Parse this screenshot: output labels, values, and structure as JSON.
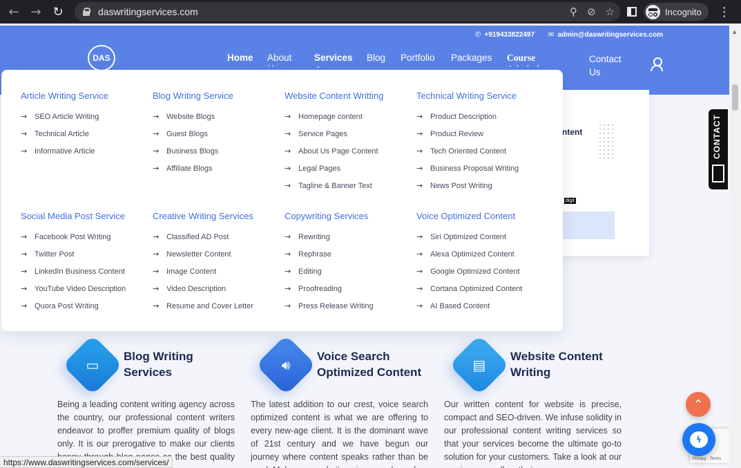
{
  "browser": {
    "url": "daswritingservices.com",
    "profile_label": "Incognito",
    "status_url": "https://www.daswritingservices.com/services/"
  },
  "site": {
    "phone": "+919433822497",
    "email": "admin@daswritingservices.com",
    "logo_text": "DAS",
    "nav": {
      "home": "Home",
      "about": "About Us",
      "services": "Services",
      "blog": "Blog",
      "portfolio": "Portfolio",
      "packages": "Packages",
      "course": "Course Admission",
      "contact": "Contact Us"
    },
    "hero_fragment": {
      "text": "ntent",
      "badge": "digit"
    },
    "colors": {
      "header": "#5a82e6",
      "menu_title": "#3f6fd9",
      "accent_orange": "#f0714e"
    }
  },
  "mega_menu": [
    {
      "title": "Article Writing Service",
      "items": [
        "SEO Article Writing",
        "Technical Article",
        "Informative Article"
      ]
    },
    {
      "title": "Blog Writing Service",
      "items": [
        "Website Blogs",
        "Guest Blogs",
        "Business Blogs",
        "Affiliate Blogs"
      ]
    },
    {
      "title": "Website Content Writting",
      "items": [
        "Homepage content",
        "Service Pages",
        "About Us Page Content",
        "Legal Pages",
        "Tagline & Banner Text"
      ]
    },
    {
      "title": "Technical Writing Service",
      "items": [
        "Product Description",
        "Product Review",
        "Tech Oriented Content",
        "Business Proposal Writing",
        "News Post Writing"
      ]
    },
    {
      "title": "Social Media Post Service",
      "items": [
        "Facebook Post Writing",
        "Twitter Post",
        "LinkedIn Business Content",
        "YouTube Video Description",
        "Quora Post Writing"
      ]
    },
    {
      "title": "Creative Writing Services",
      "items": [
        "Classified AD Post",
        "Newsletter Content",
        "Image Content",
        "Video Description",
        "Resume and Cover Letter"
      ]
    },
    {
      "title": "Copywriting Services",
      "items": [
        "Rewriting",
        "Rephrase",
        "Editing",
        "Proofreading",
        "Press Release Writing"
      ]
    },
    {
      "title": "Voice Optimized Content",
      "items": [
        "Siri Optimized Content",
        "Alexa Optimized Content",
        "Google Optimized Content",
        "Cortana Optimized Content",
        "AI Based Content"
      ]
    }
  ],
  "features": [
    {
      "title": "Blog Writing Services",
      "icon": "archive-box-icon",
      "body": "Being a leading content writing agency across the country, our professional content writers endeavor to proffer premium quality of blogs only. It is our prerogative to make our clients happy through blog pages as the best quality content",
      "color": "#1f8fe0"
    },
    {
      "title": "Voice Search Optimized Content",
      "icon": "speaker-icon",
      "body": "The latest addition to our crest, voice search optimized content is what we are offering to every new-age client. It is the dominant wave of 21st century and we have begun our journey where content speaks rather than be read. Make your website voice-search ready",
      "color": "#3a7be6"
    },
    {
      "title": "Website Content Writing",
      "icon": "document-icon",
      "body": "Our written content for website is precise, compact and SEO-driven. We infuse solidity in our professional content writing services so that your services become the ultimate go-to solution for your customers. Take a look at our services as well as their",
      "color": "#2d96ea"
    }
  ],
  "widgets": {
    "contact_tab": "CONTACT",
    "recaptcha_text": "Privacy - Terms"
  }
}
